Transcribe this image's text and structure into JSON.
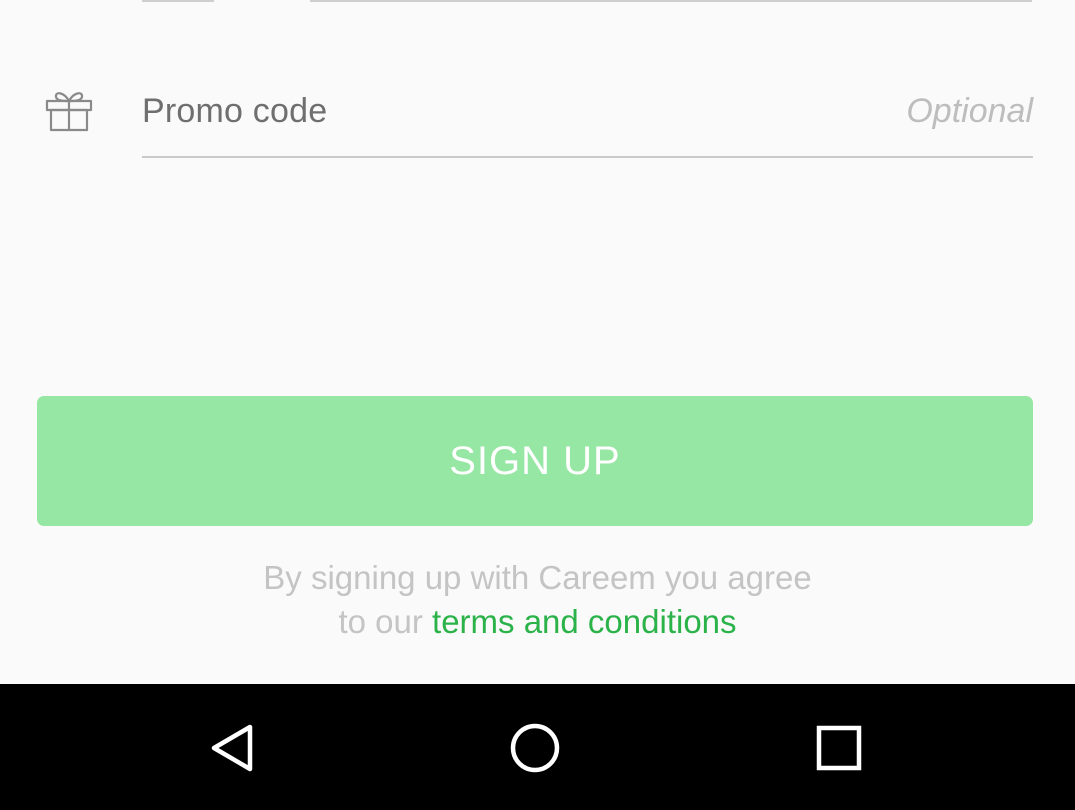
{
  "form": {
    "promo": {
      "icon": "gift-icon",
      "label": "Promo code",
      "placeholder": "Optional"
    }
  },
  "signup": {
    "button_label": "SIGN UP",
    "button_color": "#96e6a4"
  },
  "terms": {
    "line1": "By signing up with Careem you agree",
    "line2_prefix": "to our ",
    "link_text": "terms and conditions",
    "link_color": "#2bb34a"
  },
  "navbar": {
    "back_icon": "back-triangle-icon",
    "home_icon": "home-circle-icon",
    "recents_icon": "recents-square-icon"
  }
}
